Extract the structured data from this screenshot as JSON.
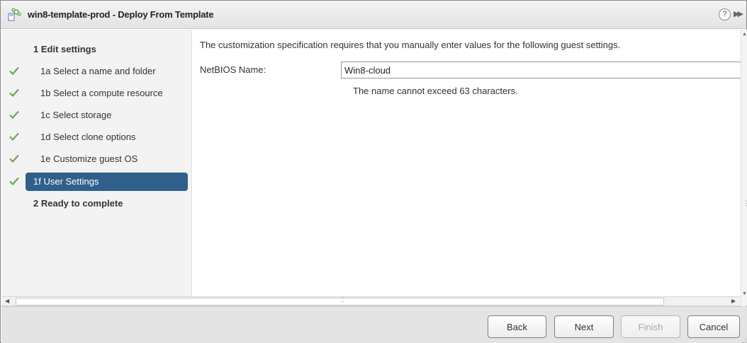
{
  "window": {
    "title": "win8-template-prod - Deploy From Template",
    "help_label": "?",
    "collapse_label": "▶▶"
  },
  "nav": {
    "step1": "1 Edit settings",
    "items": [
      {
        "label": "1a Select a name and folder",
        "completed": true
      },
      {
        "label": "1b Select a compute resource",
        "completed": true
      },
      {
        "label": "1c Select storage",
        "completed": true
      },
      {
        "label": "1d Select clone options",
        "completed": true
      },
      {
        "label": "1e Customize guest OS",
        "completed": true
      },
      {
        "label": "1f User Settings",
        "completed": true,
        "active": true
      }
    ],
    "step2": "2 Ready to complete"
  },
  "content": {
    "description": "The customization specification requires that you manually enter values for the following guest settings.",
    "netbios_label": "NetBIOS Name:",
    "netbios_value": "Win8-cloud",
    "hint": "The name cannot exceed 63 characters."
  },
  "footer": {
    "back": "Back",
    "next": "Next",
    "finish": "Finish",
    "cancel": "Cancel"
  },
  "colors": {
    "accent": "#2f5f8a",
    "check": "#6aa84f"
  }
}
